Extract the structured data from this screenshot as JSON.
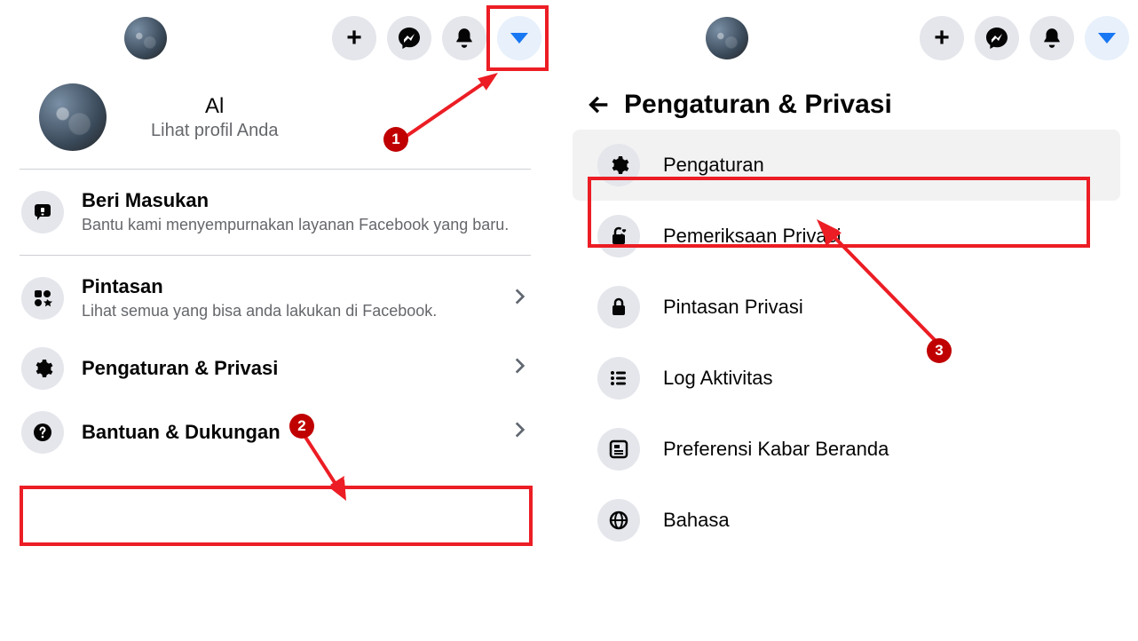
{
  "annotations": {
    "step1": "1",
    "step2": "2",
    "step3": "3"
  },
  "left": {
    "profile": {
      "name": "Al",
      "subtitle": "Lihat profil Anda"
    },
    "feedback": {
      "title": "Beri Masukan",
      "subtitle": "Bantu kami menyempurnakan layanan Facebook yang baru."
    },
    "shortcuts": {
      "title": "Pintasan",
      "subtitle": "Lihat semua yang bisa anda lakukan di Facebook."
    },
    "settings": {
      "title": "Pengaturan & Privasi"
    },
    "help": {
      "title": "Bantuan & Dukungan"
    }
  },
  "right": {
    "header": "Pengaturan & Privasi",
    "items": {
      "settings": "Pengaturan",
      "privacy_checkup": "Pemeriksaan Privasi",
      "privacy_shortcuts": "Pintasan Privasi",
      "activity_log": "Log Aktivitas",
      "news_feed": "Preferensi Kabar Beranda",
      "language": "Bahasa"
    }
  }
}
